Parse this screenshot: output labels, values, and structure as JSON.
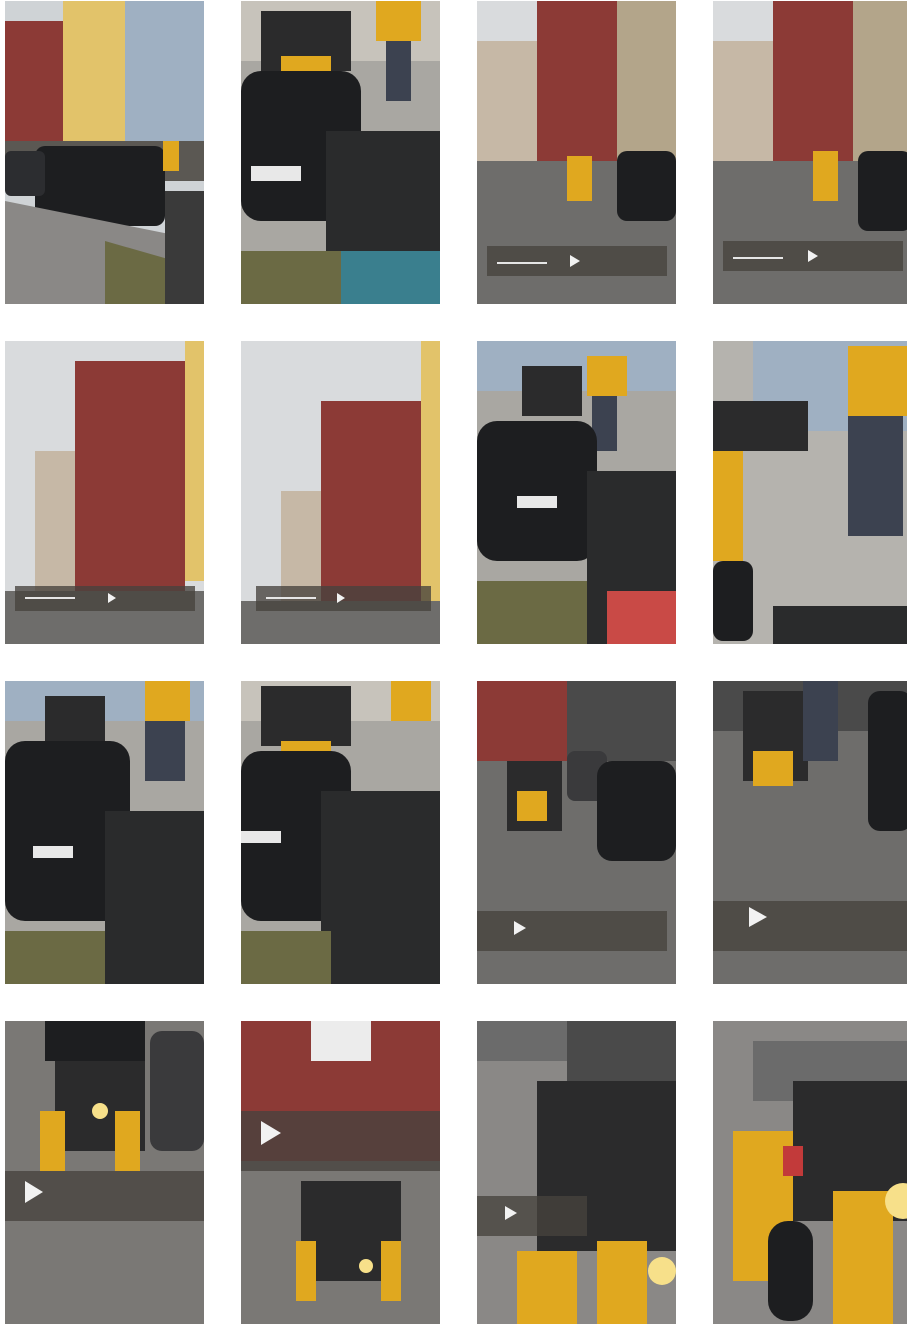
{
  "grid": {
    "rows": 4,
    "columns": 4,
    "background": "#ffffff"
  },
  "frames": [
    {
      "id": 1,
      "scene": "street-buildings-parked-cars",
      "has_video_controls": false
    },
    {
      "id": 2,
      "scene": "audi-closeup-courier",
      "has_video_controls": false
    },
    {
      "id": 3,
      "scene": "street-red-building-cart",
      "has_video_controls": true
    },
    {
      "id": 4,
      "scene": "street-red-building-cart",
      "has_video_controls": true
    },
    {
      "id": 5,
      "scene": "red-building-tree",
      "has_video_controls": true
    },
    {
      "id": 6,
      "scene": "red-building-tree",
      "has_video_controls": true
    },
    {
      "id": 7,
      "scene": "audi-closeup-courier",
      "has_video_controls": false
    },
    {
      "id": 8,
      "scene": "courier-cart-closeup",
      "has_video_controls": false
    },
    {
      "id": 9,
      "scene": "audi-closeup-courier",
      "has_video_controls": false
    },
    {
      "id": 10,
      "scene": "audi-closeup-courier",
      "has_video_controls": false
    },
    {
      "id": 11,
      "scene": "cart-approaching-street",
      "has_video_controls": true
    },
    {
      "id": 12,
      "scene": "cart-approaching-street",
      "has_video_controls": true
    },
    {
      "id": 13,
      "scene": "cart-front-closeup",
      "has_video_controls": true
    },
    {
      "id": 14,
      "scene": "cart-red-building",
      "has_video_controls": true
    },
    {
      "id": 15,
      "scene": "cart-blurred-motion",
      "has_video_controls": true
    },
    {
      "id": 16,
      "scene": "cart-blurred-motion",
      "has_video_controls": false
    }
  ],
  "colors": {
    "sky": "#d9dbdd",
    "brick_red": "#8c3a36",
    "yellow_building": "#e2c36a",
    "asphalt": "#6e6d6b",
    "car_black": "#1d1e20",
    "courier_yellow": "#e0a81f",
    "grass": "#6b6a44"
  }
}
